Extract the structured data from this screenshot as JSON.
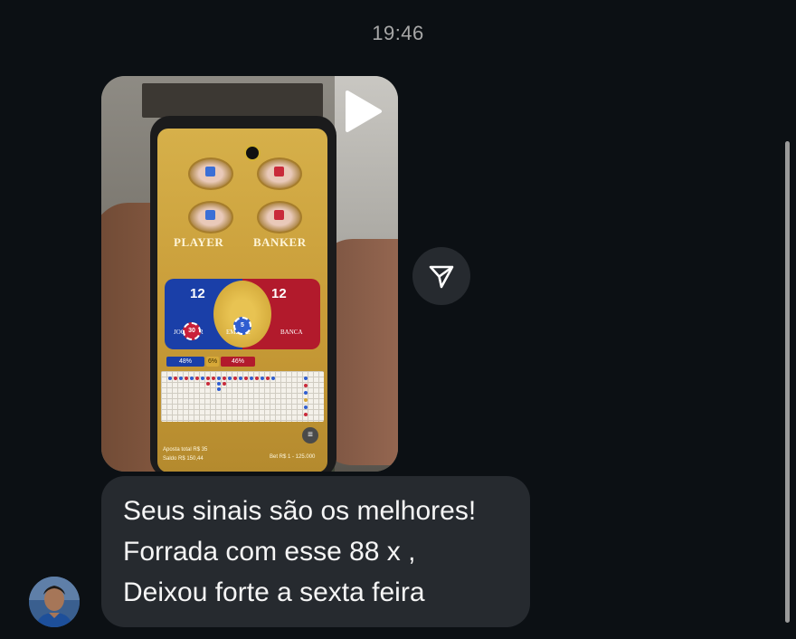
{
  "timestamp": "19:46",
  "video": {
    "game": {
      "player_label": "PLAYER",
      "banker_label": "BANKER",
      "player_score": "12",
      "banker_score": "12",
      "player_sub": "JOGADOR",
      "banker_sub": "BANCA",
      "tie_sub": "EMPATE",
      "chip_player": "30",
      "chip_tie": "5",
      "player_pct": "48%",
      "tie_pct": "6%",
      "banker_pct": "46%",
      "total_bet": "Aposta total R$ 35",
      "balance": "Saldo R$ 150,44",
      "bet_range": "Bet R$ 1 - 125.000"
    }
  },
  "message": {
    "lines": [
      "Seus sinais são os melhores!",
      "Forrada com esse 88 x ,",
      "Deixou forte a sexta feira"
    ]
  },
  "colors": {
    "background": "#0c1014",
    "bubble": "#262a2f",
    "text": "#f5f5f5",
    "timestamp": "#a8a8a8"
  },
  "icons": {
    "play": "play-icon",
    "share": "paper-plane-icon",
    "menu": "hamburger-icon"
  }
}
